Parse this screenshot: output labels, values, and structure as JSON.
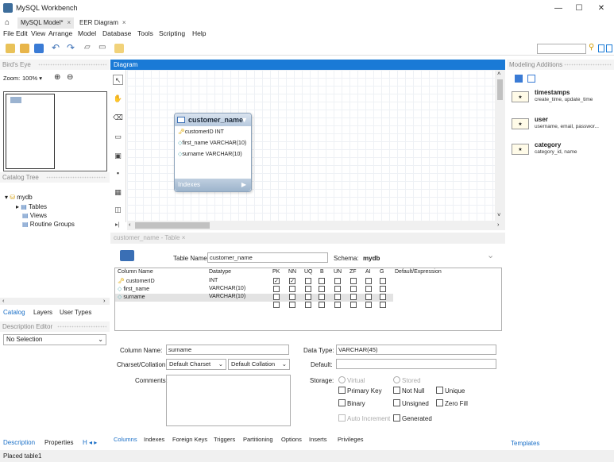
{
  "window": {
    "title": "MySQL Workbench"
  },
  "tabs": [
    {
      "label": "MySQL Model*"
    },
    {
      "label": "EER Diagram"
    }
  ],
  "menu": [
    "File",
    "Edit",
    "View",
    "Arrange",
    "Model",
    "Database",
    "Tools",
    "Scripting",
    "Help"
  ],
  "birds_eye": {
    "title": "Bird's Eye",
    "zoom_label": "Zoom:",
    "zoom_value": "100%"
  },
  "catalog": {
    "title": "Catalog Tree",
    "schema": "mydb",
    "items": [
      "Tables",
      "Views",
      "Routine Groups"
    ],
    "tabs": [
      "Catalog",
      "Layers",
      "User Types"
    ]
  },
  "description": {
    "title": "Description Editor",
    "selection": "No Selection",
    "tabs": [
      "Description",
      "Properties"
    ]
  },
  "diagram": {
    "title": "Diagram",
    "entity": {
      "name": "customer_name",
      "columns": [
        "customerID INT",
        "first_name VARCHAR(10)",
        "surname VARCHAR(10)"
      ],
      "indexes_label": "Indexes"
    }
  },
  "table_editor": {
    "tab_title": "customer_name - Table",
    "table_name_label": "Table Name:",
    "table_name": "customer_name",
    "schema_label": "Schema:",
    "schema": "mydb",
    "headers": [
      "Column Name",
      "Datatype",
      "PK",
      "NN",
      "UQ",
      "B",
      "UN",
      "ZF",
      "AI",
      "G",
      "Default/Expression"
    ],
    "rows": [
      {
        "name": "customerID",
        "type": "INT",
        "flags": [
          true,
          true,
          false,
          false,
          false,
          false,
          false,
          false
        ]
      },
      {
        "name": "first_name",
        "type": "VARCHAR(10)",
        "flags": [
          false,
          false,
          false,
          false,
          false,
          false,
          false,
          false
        ]
      },
      {
        "name": "surname",
        "type": "VARCHAR(10)",
        "flags": [
          false,
          false,
          false,
          false,
          false,
          false,
          false,
          false
        ]
      }
    ],
    "column_name_label": "Column Name:",
    "column_name": "surname",
    "data_type_label": "Data Type:",
    "data_type": "VARCHAR(45)",
    "charset_label": "Charset/Collation:",
    "charset": "Default Charset",
    "collation": "Default Collation",
    "default_label": "Default:",
    "default_value": "",
    "comments_label": "Comments:",
    "storage_label": "Storage:",
    "storage_options": [
      "Virtual",
      "Stored"
    ],
    "checks": [
      "Primary Key",
      "Not Null",
      "Unique",
      "Binary",
      "Unsigned",
      "Zero Fill",
      "Auto Increment",
      "Generated"
    ],
    "bottom_tabs": [
      "Columns",
      "Indexes",
      "Foreign Keys",
      "Triggers",
      "Partitioning",
      "Options",
      "Inserts",
      "Privileges"
    ]
  },
  "modeling": {
    "title": "Modeling Additions",
    "snippets": [
      {
        "title": "timestamps",
        "sub": "create_time, update_time"
      },
      {
        "title": "user",
        "sub": "username, email, passwor..."
      },
      {
        "title": "category",
        "sub": "category_id, name"
      }
    ],
    "tab": "Templates"
  },
  "status": {
    "text": "Placed table1"
  },
  "icons": [
    "home-icon",
    "new-file-icon",
    "open-icon",
    "save-icon",
    "undo-icon",
    "redo-icon",
    "search-icon",
    "zoom-in-icon",
    "zoom-out-icon"
  ],
  "accent_color": "#1a7ad6"
}
